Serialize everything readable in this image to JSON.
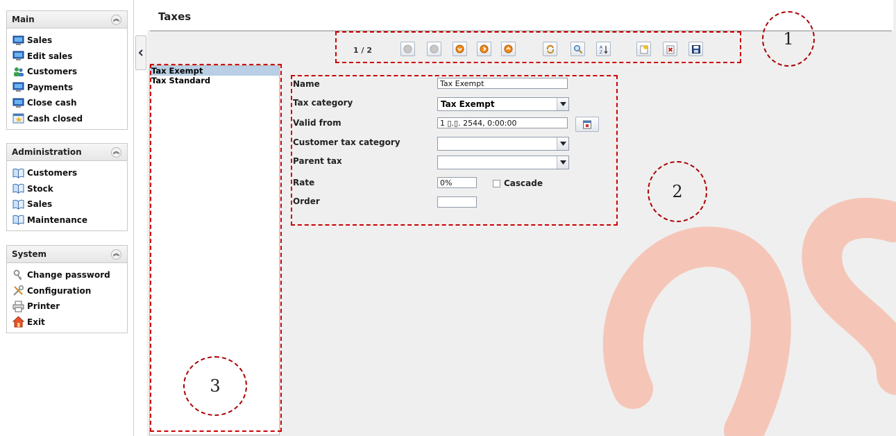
{
  "sidebar": {
    "sections": [
      {
        "title": "Main",
        "items": [
          {
            "label": "Sales",
            "icon": "monitor-icon"
          },
          {
            "label": "Edit sales",
            "icon": "monitor-icon"
          },
          {
            "label": "Customers",
            "icon": "users-icon"
          },
          {
            "label": "Payments",
            "icon": "monitor-icon"
          },
          {
            "label": "Close cash",
            "icon": "monitor-icon"
          },
          {
            "label": "Cash closed",
            "icon": "calendar-star-icon"
          }
        ]
      },
      {
        "title": "Administration",
        "items": [
          {
            "label": "Customers",
            "icon": "book-icon"
          },
          {
            "label": "Stock",
            "icon": "book-icon"
          },
          {
            "label": "Sales",
            "icon": "book-icon"
          },
          {
            "label": "Maintenance",
            "icon": "book-icon"
          }
        ]
      },
      {
        "title": "System",
        "items": [
          {
            "label": "Change password",
            "icon": "key-icon"
          },
          {
            "label": "Configuration",
            "icon": "tools-icon"
          },
          {
            "label": "Printer",
            "icon": "printer-icon"
          },
          {
            "label": "Exit",
            "icon": "home-icon"
          }
        ]
      }
    ]
  },
  "page": {
    "title": "Taxes"
  },
  "toolbar": {
    "page_indicator": "1 / 2"
  },
  "list": {
    "items": [
      "Tax Exempt",
      "Tax Standard"
    ],
    "selected": "Tax Exempt"
  },
  "form": {
    "name_label": "Name",
    "name_value": "Tax Exempt",
    "tax_category_label": "Tax category",
    "tax_category_value": "Tax Exempt",
    "valid_from_label": "Valid from",
    "valid_from_value": "1 ▯.▯. 2544, 0:00:00",
    "customer_tax_category_label": "Customer tax category",
    "customer_tax_category_value": "",
    "parent_tax_label": "Parent tax",
    "parent_tax_value": "",
    "rate_label": "Rate",
    "rate_value": "0%",
    "cascade_label": "Cascade",
    "order_label": "Order",
    "order_value": ""
  },
  "annotations": [
    "1",
    "2",
    "3"
  ],
  "colors": {
    "annotation": "#cc0000",
    "selection": "#b8cfe5",
    "watermark": "#f4c4b8"
  }
}
